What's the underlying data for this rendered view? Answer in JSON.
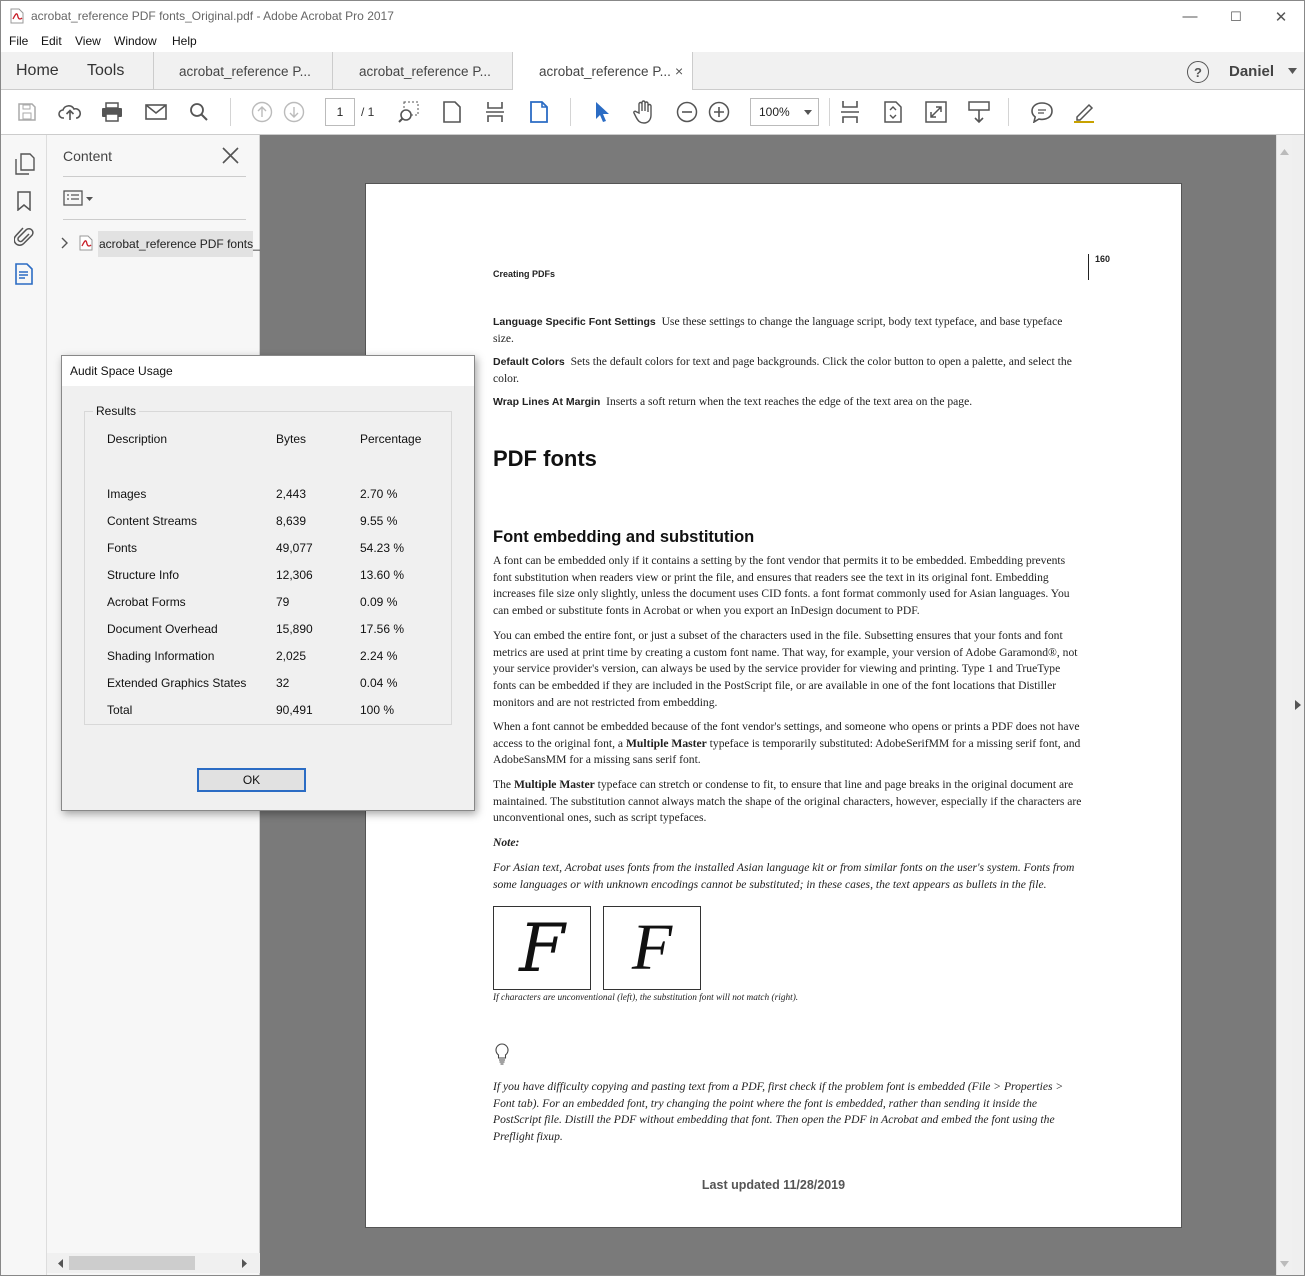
{
  "window": {
    "title": "acrobat_reference PDF fonts_Original.pdf - Adobe Acrobat Pro 2017",
    "minimize_glyph": "—",
    "maximize_glyph": "☐",
    "close_glyph": "✕"
  },
  "menu": [
    "File",
    "Edit",
    "View",
    "Window",
    "Help"
  ],
  "tabs": {
    "home": "Home",
    "tools": "Tools",
    "docs": [
      "acrobat_reference P...",
      "acrobat_reference P...",
      "acrobat_reference P..."
    ],
    "user": "Daniel",
    "help_glyph": "?",
    "close_glyph": "×"
  },
  "toolbar": {
    "page_current": "1",
    "page_total": "/ 1",
    "zoom": "100%"
  },
  "nav_panel": {
    "title": "Content",
    "tree_item": "acrobat_reference PDF fonts_"
  },
  "dialog": {
    "title": "Audit Space Usage",
    "group_label": "Results",
    "headers": [
      "Description",
      "Bytes",
      "Percentage"
    ],
    "rows": [
      [
        "Images",
        "2,443",
        "2.70 %"
      ],
      [
        "Content Streams",
        "8,639",
        "9.55 %"
      ],
      [
        "Fonts",
        "49,077",
        "54.23 %"
      ],
      [
        "Structure Info",
        "12,306",
        "13.60 %"
      ],
      [
        "Acrobat Forms",
        "79",
        "0.09 %"
      ],
      [
        "Document Overhead",
        "15,890",
        "17.56 %"
      ],
      [
        "Shading Information",
        "2,025",
        "2.24 %"
      ],
      [
        "Extended Graphics States",
        "32",
        "0.04 %"
      ],
      [
        "Total",
        "90,491",
        "100 %"
      ]
    ],
    "ok_label": "OK"
  },
  "page": {
    "running_head": "Creating PDFs",
    "page_number": "160",
    "p1_term": "Language Specific Font Settings",
    "p1_text": "Use these settings to change the language script, body text typeface, and base typeface size.",
    "p2_term": "Default Colors",
    "p2_text": "Sets the default colors for text and page backgrounds. Click the color button to open a palette, and select the color.",
    "p3_term": "Wrap Lines At Margin",
    "p3_text": "Inserts a soft return when the text reaches the edge of the text area on the page.",
    "h1": "PDF fonts",
    "h2": "Font embedding and substitution",
    "para1": "A font can be embedded only if it contains a setting by the font vendor that permits it to be embedded. Embedding prevents font substitution when readers view or print the file, and ensures that readers see the text in its original font. Embedding increases file size only slightly, unless the document uses CID fonts. a font format commonly used for Asian languages. You can embed or substitute fonts in Acrobat or when you export an InDesign document to PDF.",
    "para2": "You can embed the entire font, or just a subset of the characters used in the file. Subsetting ensures that your fonts and font metrics are used at print time by creating a custom font name. That way, for example, your version of Adobe Garamond®, not your service provider's version, can always be used by the service provider for viewing and printing. Type 1 and TrueType fonts can be embedded if they are included in the PostScript file, or are available in one of the font locations that Distiller monitors and are not restricted from embedding.",
    "para3a": "When a font cannot be embedded because of the font vendor's settings, and someone who opens or prints a PDF does not have access to the original font, a ",
    "para3_bold": "Multiple Master",
    "para3b": " typeface is temporarily substituted: AdobeSerifMM for a missing serif font, and AdobeSansMM for a missing sans serif font.",
    "para4a": "The ",
    "para4_bold": "Multiple Master",
    "para4b": " typeface can stretch or condense to fit, to ensure that line and page breaks in the original document are maintained. The substitution cannot always match the shape of the original characters, however, especially if the characters are unconventional ones, such as script typefaces.",
    "note_label": "Note:",
    "note_text": "For Asian text, Acrobat uses fonts from the installed Asian language kit or from similar fonts on the user's system. Fonts from some languages or with unknown encodings cannot be substituted; in these cases, the text appears as bullets in the file.",
    "fig_left_glyph": "F",
    "fig_right_glyph": "F",
    "fig_caption": "If characters are unconventional (left), the substitution font will not match (right).",
    "tip_text": "If you have difficulty copying and pasting text from a PDF, first check if the problem font is embedded (File > Properties > Font tab). For an embedded font, try changing the point where the font is embedded, rather than sending it inside the PostScript file. Distill the PDF without embedding that font. Then open the PDF in Acrobat and embed the font using the Preflight fixup.",
    "footer": "Last updated 11/28/2019"
  },
  "colors": {
    "accent": "#2b6cc4",
    "doc_bg": "#7a7a7a",
    "pdf_red": "#c8202a"
  }
}
